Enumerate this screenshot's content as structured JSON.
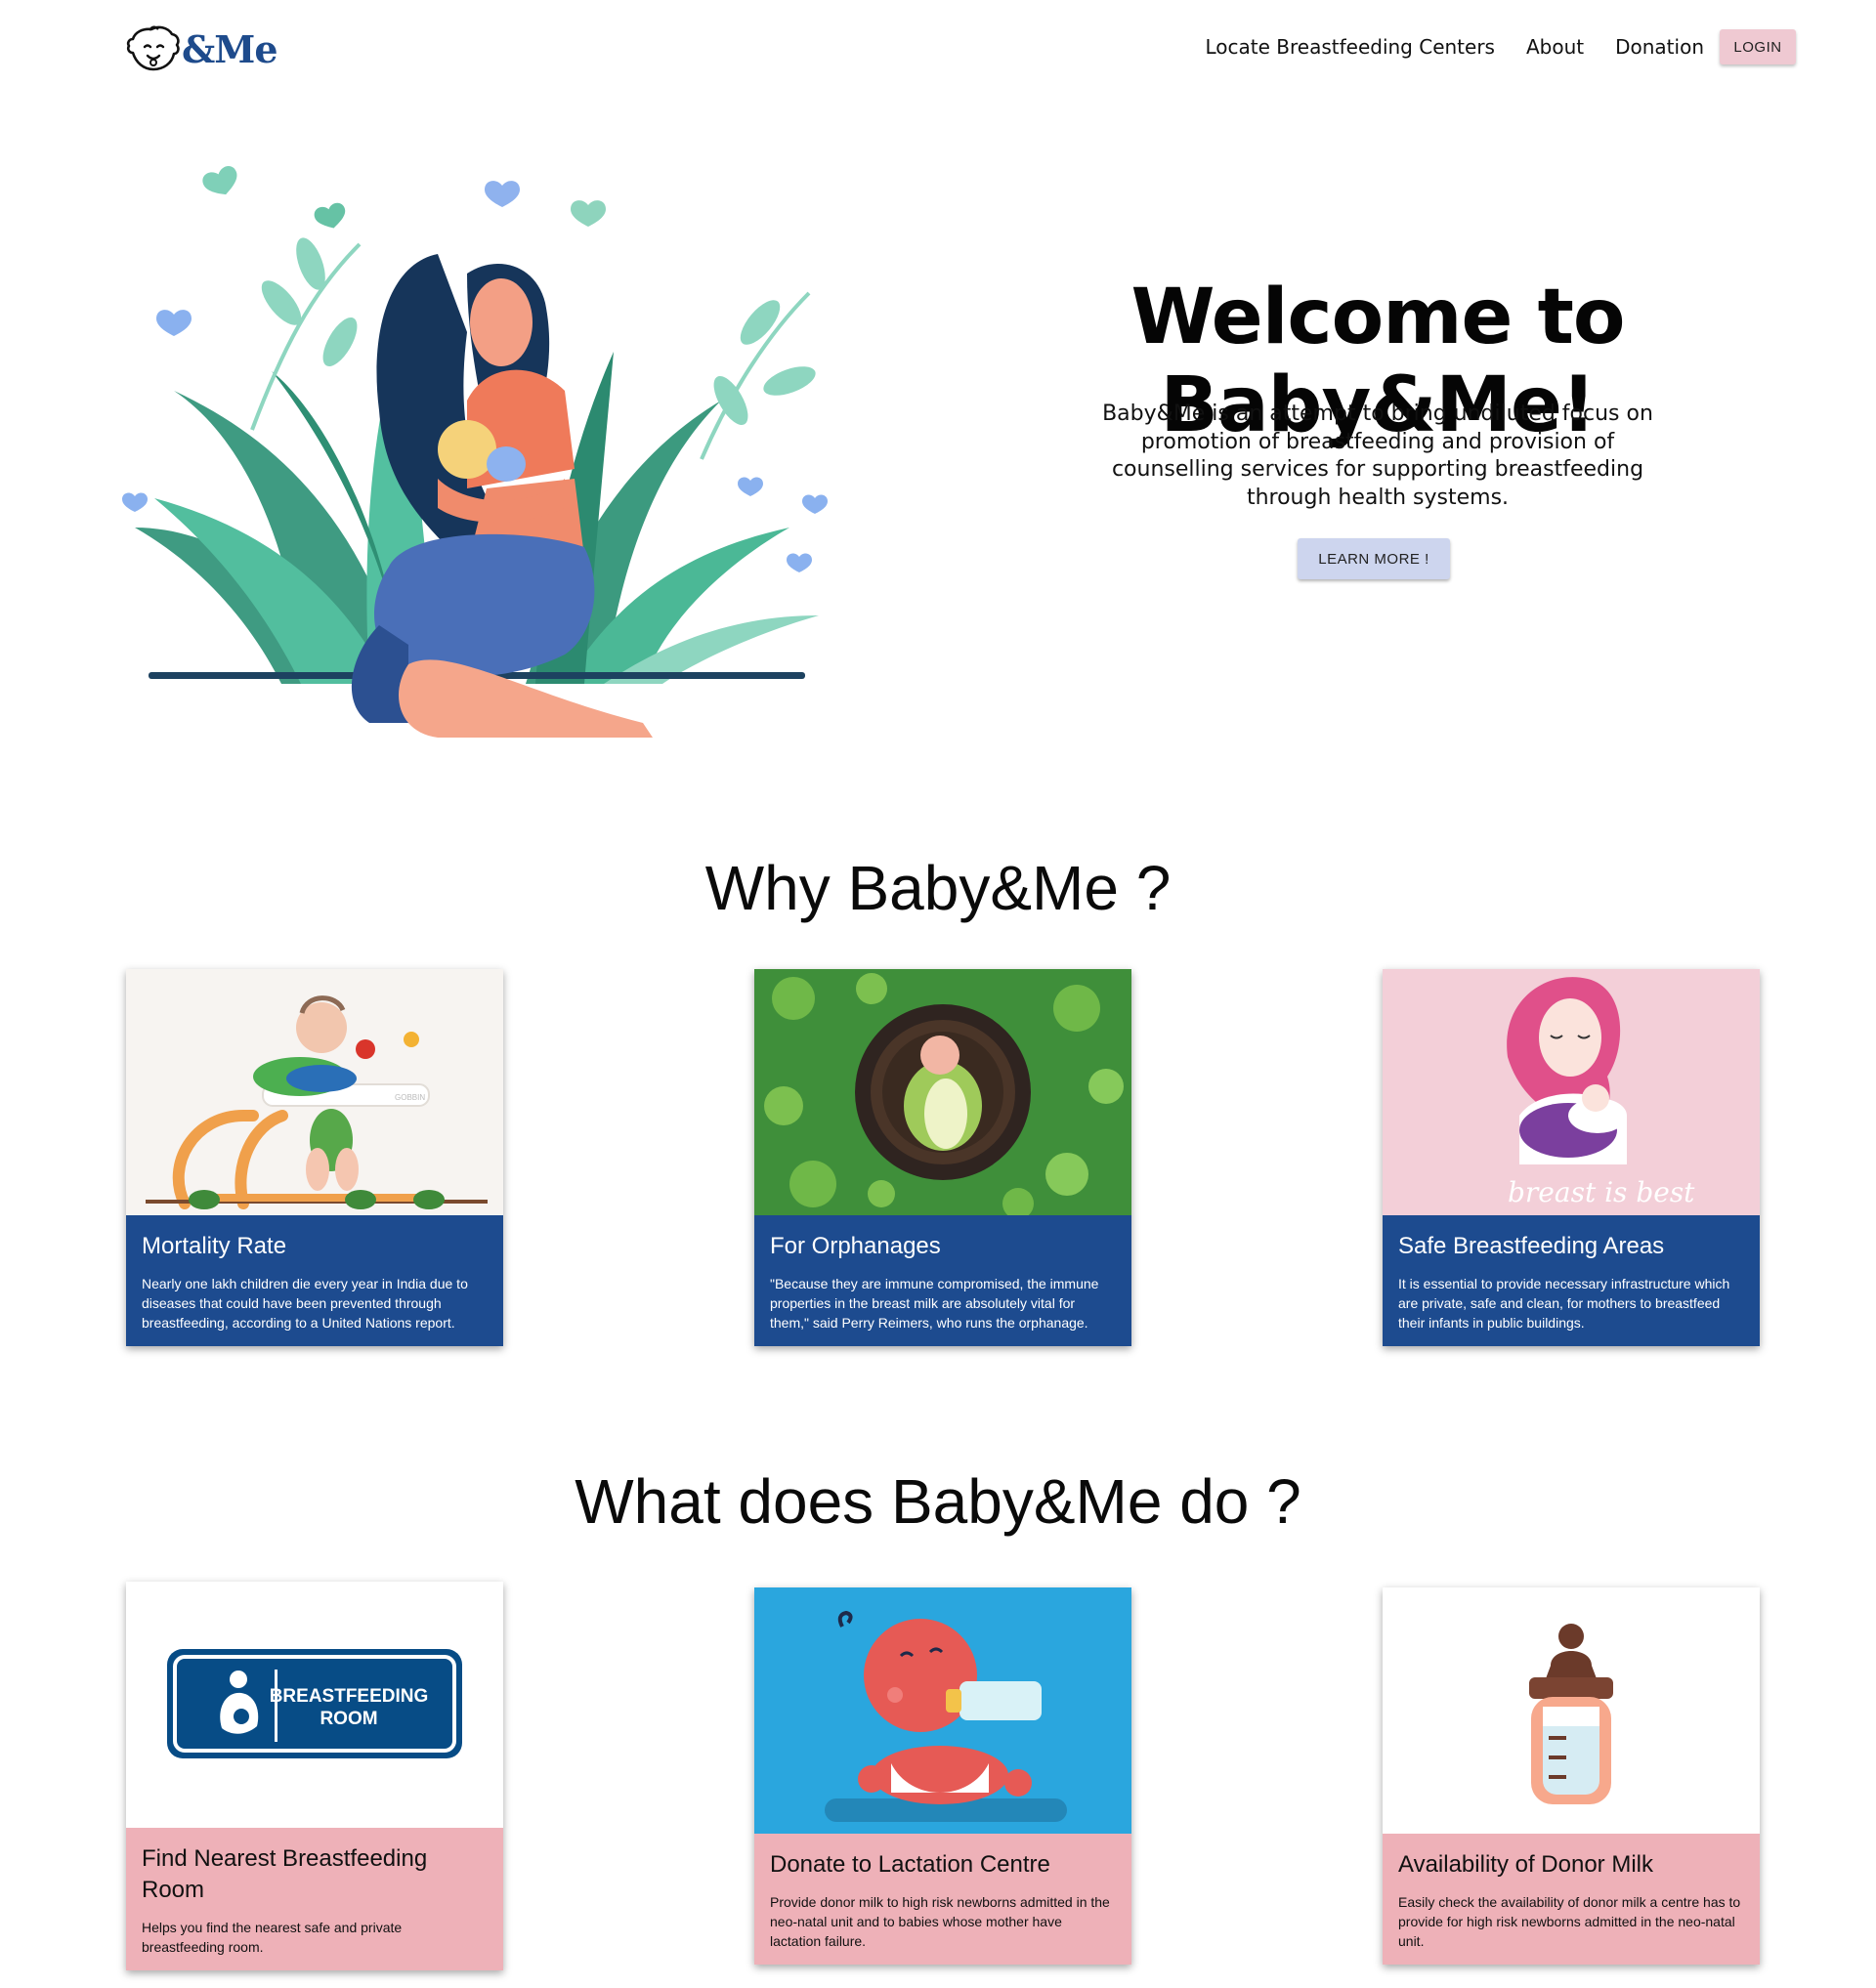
{
  "header": {
    "logo_text": "&Me",
    "nav": [
      {
        "label": "Locate Breastfeeding Centers"
      },
      {
        "label": "About"
      },
      {
        "label": "Donation"
      }
    ],
    "login_label": "LOGIN"
  },
  "hero": {
    "title": "Welcome to Baby&Me!",
    "description": "Baby&Me is an attempt to bring undiluted focus on promotion of breastfeeding and provision of counselling services for supporting breastfeeding through health systems.",
    "button_label": "LEARN MORE !"
  },
  "why": {
    "title": "Why Baby&Me ?",
    "cards": [
      {
        "title": "Mortality Rate",
        "text": "Nearly one lakh children die every year in India due to diseases that could have been prevented through breastfeeding, according to a United Nations report."
      },
      {
        "title": "For Orphanages",
        "text": "\"Because they are immune compromised, the immune properties in the breast milk are absolutely vital for them,\" said Perry Reimers, who runs the orphanage."
      },
      {
        "title": "Safe Breastfeeding Areas",
        "text": "It is essential to provide necessary infrastructure which are private, safe and clean, for mothers to breastfeed their infants in public buildings."
      }
    ]
  },
  "what": {
    "title": "What does Baby&Me do ?",
    "cards": [
      {
        "title": "Find Nearest Breastfeeding Room",
        "text": "Helps you find the nearest safe and private breastfeeding room.",
        "sign_line1": "BREASTFEEDING",
        "sign_line2": "ROOM"
      },
      {
        "title": "Donate to Lactation Centre",
        "text": "Provide donor milk to high risk newborns admitted in the neo-natal unit and to babies whose mother have lactation failure."
      },
      {
        "title": "Availability of Donor Milk",
        "text": "Easily check the availability of donor milk a centre has to provide for high risk newborns admitted in the neo-natal unit."
      }
    ]
  },
  "image_text": {
    "breast_is_best": "breast is best",
    "walker_brand": "GOBBIN"
  },
  "colors": {
    "brand_blue": "#1d4b8f",
    "card_pink": "#eeb1b8",
    "login_bg": "#efc9d2",
    "learn_bg": "#cdd5ee"
  },
  "icons": [
    "baby-face-logo-icon",
    "breastfeeding-sign-icon",
    "baby-bottle-icon"
  ]
}
